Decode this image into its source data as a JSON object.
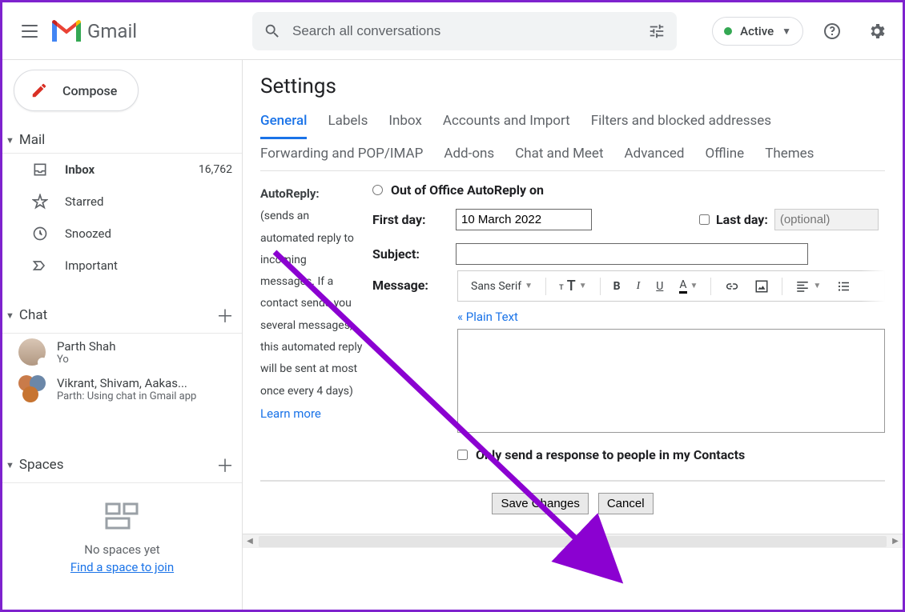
{
  "header": {
    "brand": "Gmail",
    "search_placeholder": "Search all conversations",
    "status_label": "Active"
  },
  "sidebar": {
    "compose": "Compose",
    "sections": {
      "mail": {
        "title": "Mail",
        "items": [
          {
            "icon": "inbox",
            "label": "Inbox",
            "count": "16,762",
            "bold": true
          },
          {
            "icon": "star",
            "label": "Starred"
          },
          {
            "icon": "clock",
            "label": "Snoozed"
          },
          {
            "icon": "important",
            "label": "Important"
          }
        ]
      },
      "chat": {
        "title": "Chat",
        "items": [
          {
            "title": "Parth Shah",
            "sub": "Yo"
          },
          {
            "title": "Vikrant, Shivam, Aakas...",
            "sub": "Parth: Using chat in Gmail app"
          }
        ]
      },
      "spaces": {
        "title": "Spaces",
        "empty_text": "No spaces yet",
        "link_text": "Find a space to join"
      }
    }
  },
  "settings": {
    "title": "Settings",
    "tabs_row1": [
      "General",
      "Labels",
      "Inbox",
      "Accounts and Import",
      "Filters and blocked addresses"
    ],
    "tabs_row2": [
      "Forwarding and POP/IMAP",
      "Add-ons",
      "Chat and Meet",
      "Advanced",
      "Offline",
      "Themes"
    ],
    "active_tab": "General",
    "autoreply": {
      "heading": "AutoReply:",
      "desc": "(sends an automated reply to incoming messages. If a contact sends you several messages, this automated reply will be sent at most once every 4 days)",
      "learn_more": "Learn more",
      "radio_label": "Out of Office AutoReply on",
      "first_day_label": "First day:",
      "first_day_value": "10 March 2022",
      "last_day_label": "Last day:",
      "last_day_placeholder": "(optional)",
      "subject_label": "Subject:",
      "subject_value": "",
      "message_label": "Message:",
      "font_name": "Sans Serif",
      "plain_text": "« Plain Text",
      "contacts_checkbox": "Only send a response to people in my Contacts"
    },
    "buttons": {
      "save": "Save Changes",
      "cancel": "Cancel"
    }
  }
}
